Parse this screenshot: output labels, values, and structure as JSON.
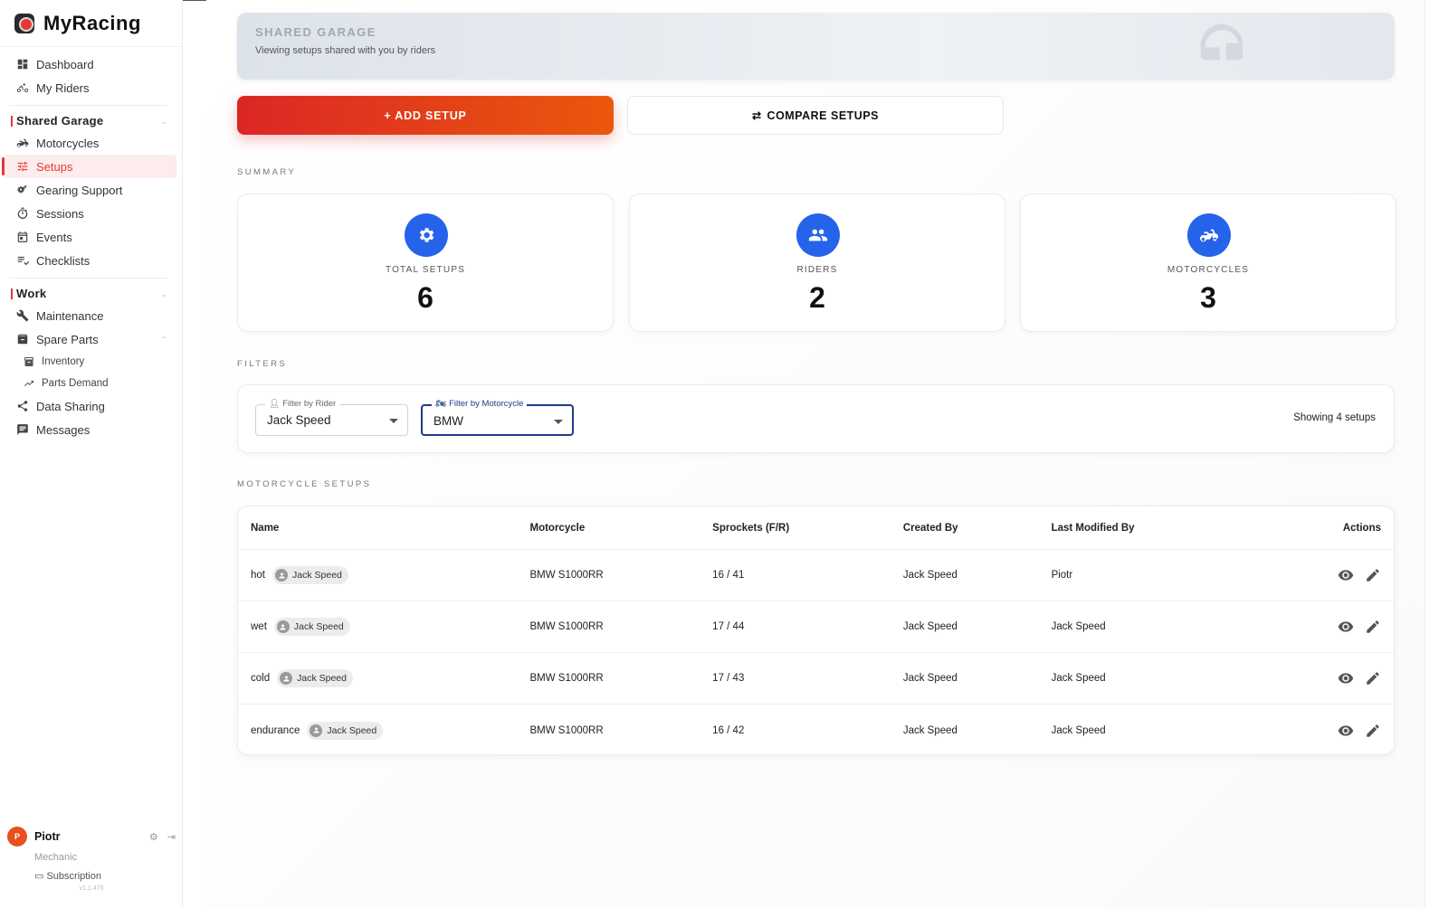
{
  "app": {
    "name": "MyRacing"
  },
  "sidebar": {
    "top_items": [
      {
        "label": "Dashboard",
        "icon": "dashboard-icon"
      },
      {
        "label": "My Riders",
        "icon": "bike-icon"
      }
    ],
    "sections": [
      {
        "title": "Shared Garage",
        "items": [
          {
            "label": "Motorcycles",
            "icon": "motorcycle-icon"
          },
          {
            "label": "Setups",
            "icon": "tune-icon",
            "active": true
          },
          {
            "label": "Gearing Support",
            "icon": "gears-icon"
          },
          {
            "label": "Sessions",
            "icon": "stopwatch-icon"
          },
          {
            "label": "Events",
            "icon": "calendar-icon"
          },
          {
            "label": "Checklists",
            "icon": "checklist-icon"
          }
        ]
      },
      {
        "title": "Work",
        "items": [
          {
            "label": "Maintenance",
            "icon": "wrench-icon"
          },
          {
            "label": "Spare Parts",
            "icon": "archive-icon"
          }
        ],
        "sub_items": [
          {
            "label": "Inventory",
            "icon": "inventory-icon"
          },
          {
            "label": "Parts Demand",
            "icon": "trending-icon"
          }
        ],
        "after_items": [
          {
            "label": "Data Sharing",
            "icon": "share-icon"
          },
          {
            "label": "Messages",
            "icon": "message-icon"
          }
        ]
      }
    ],
    "user": {
      "initial": "P",
      "name": "Piotr",
      "role": "Mechanic",
      "subscription": "Subscription",
      "version": "v1.1.470"
    }
  },
  "banner": {
    "title": "SHARED GARAGE",
    "subtitle": "Viewing setups shared with you by riders"
  },
  "actions": {
    "add_label": "+ ADD SETUP",
    "compare_label": "COMPARE SETUPS"
  },
  "summary": {
    "heading": "SUMMARY",
    "cards": [
      {
        "label": "TOTAL SETUPS",
        "value": "6",
        "icon": "gear-icon"
      },
      {
        "label": "RIDERS",
        "value": "2",
        "icon": "people-icon"
      },
      {
        "label": "MOTORCYCLES",
        "value": "3",
        "icon": "motorcycle-icon"
      }
    ]
  },
  "filters": {
    "heading": "FILTERS",
    "rider": {
      "label": "Filter by Rider",
      "value": "Jack Speed"
    },
    "motorcycle": {
      "label": "Filter by Motorcycle",
      "value": "BMW"
    },
    "showing": "Showing 4 setups"
  },
  "table": {
    "heading": "MOTORCYCLE SETUPS",
    "columns": [
      "Name",
      "Motorcycle",
      "Sprockets (F/R)",
      "Created By",
      "Last Modified By",
      "Actions"
    ],
    "rows": [
      {
        "name": "hot",
        "rider": "Jack Speed",
        "motorcycle": "BMW S1000RR",
        "sprockets": "16 / 41",
        "created_by": "Jack Speed",
        "modified_by": "Piotr"
      },
      {
        "name": "wet",
        "rider": "Jack Speed",
        "motorcycle": "BMW S1000RR",
        "sprockets": "17 / 44",
        "created_by": "Jack Speed",
        "modified_by": "Jack Speed"
      },
      {
        "name": "cold",
        "rider": "Jack Speed",
        "motorcycle": "BMW S1000RR",
        "sprockets": "17 / 43",
        "created_by": "Jack Speed",
        "modified_by": "Jack Speed"
      },
      {
        "name": "endurance",
        "rider": "Jack Speed",
        "motorcycle": "BMW S1000RR",
        "sprockets": "16 / 42",
        "created_by": "Jack Speed",
        "modified_by": "Jack Speed"
      }
    ]
  },
  "colors": {
    "accent": "#e53935",
    "primary_blue": "#2563eb",
    "focus": "#1e3a8a"
  }
}
